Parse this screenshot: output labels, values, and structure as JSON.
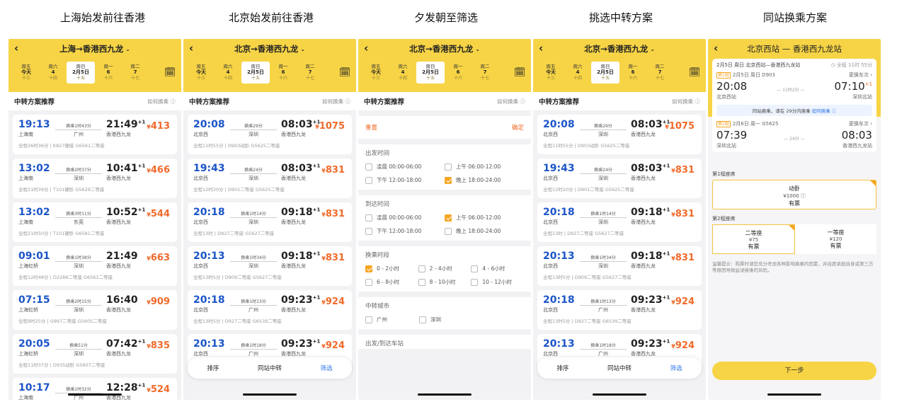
{
  "captions": [
    "上海始发前往香港",
    "北京始发前往香港",
    "夕发朝至筛选",
    "挑选中转方案",
    "同站换乘方案"
  ],
  "dates": [
    {
      "w": "周五",
      "d": "今天",
      "l": "十三"
    },
    {
      "w": "周六",
      "d": "4",
      "l": "十四"
    },
    {
      "w": "周日",
      "d": "2月5日",
      "l": "十五"
    },
    {
      "w": "周一",
      "d": "6",
      "l": "十六"
    },
    {
      "w": "周二",
      "d": "7",
      "l": "十七"
    }
  ],
  "p1": {
    "title": "上海→香港西九龙",
    "sec": "中转方案推荐",
    "help": "如何换乘 ⓘ",
    "cards": [
      {
        "dep": "19:13",
        "from": "上海南",
        "trans": "换乘1时43分",
        "via": "广州",
        "arr": "21:49",
        "plus": "+1",
        "to": "香港西九龙",
        "price": "413",
        "info": "全程26时36分 | K827硬座 G6561二等座"
      },
      {
        "dep": "13:02",
        "from": "上海南",
        "trans": "换乘2时37分",
        "via": "深圳",
        "arr": "10:41",
        "plus": "+1",
        "to": "香港西九龙",
        "price": "466",
        "info": "全程21时39分 | T101硬卧 G5629二等座"
      },
      {
        "dep": "13:02",
        "from": "上海南",
        "trans": "换乘3时11分",
        "via": "东莞",
        "arr": "10:52",
        "plus": "+1",
        "to": "香港西九龙",
        "price": "544",
        "info": "全程21时50分 | T101硬卧 G6581二等座"
      },
      {
        "dep": "09:01",
        "from": "上海虹桥",
        "trans": "换乘1时38分",
        "via": "深圳",
        "arr": "21:49",
        "plus": "",
        "to": "香港西九龙",
        "price": "663",
        "info": "全程12时48分 | D2289二等座 G6561二等座"
      },
      {
        "dep": "07:15",
        "from": "上海虹桥",
        "trans": "换乘2时15分",
        "via": "深圳",
        "arr": "16:40",
        "plus": "",
        "to": "香港西九龙",
        "price": "909",
        "info": "全程9时25分 | G997二等座 G5605二等座"
      },
      {
        "dep": "20:05",
        "from": "上海虹桥",
        "trans": "换乘51分",
        "via": "深圳",
        "arr": "07:42",
        "plus": "+1",
        "to": "香港西九龙",
        "price": "835",
        "info": "全程11时37分 | D935动卧 G5607二等座"
      },
      {
        "dep": "10:17",
        "from": "上海南",
        "trans": "换乘1时32分",
        "via": "广州",
        "arr": "12:28",
        "plus": "+1",
        "to": "香港西九龙",
        "price": "524",
        "info": ""
      }
    ]
  },
  "p2": {
    "title": "北京→香港西九龙",
    "sec": "中转方案推荐",
    "help": "如何换乘 ⓘ",
    "cards": [
      {
        "dep": "20:08",
        "from": "北京西",
        "trans": "换乘29分",
        "via": "深圳",
        "arr": "08:03",
        "plus": "+1",
        "to": "香港西九龙",
        "price": "1075",
        "info": "全程11时55分 | D903动卧 G5625二等座"
      },
      {
        "dep": "19:43",
        "from": "北京西",
        "trans": "换乘24分",
        "via": "深圳",
        "arr": "08:03",
        "plus": "+1",
        "to": "香港西九龙",
        "price": "831",
        "info": "全程12时20分 | D901二等座 G5625二等座"
      },
      {
        "dep": "20:18",
        "from": "北京西",
        "trans": "换乘1时14分",
        "via": "深圳",
        "arr": "09:18",
        "plus": "+1",
        "to": "香港西九龙",
        "price": "831",
        "info": "全程13时 | D927二等座 G5627二等座"
      },
      {
        "dep": "20:13",
        "from": "北京西",
        "trans": "换乘1时34分",
        "via": "深圳",
        "arr": "09:18",
        "plus": "+1",
        "to": "香港西九龙",
        "price": "831",
        "info": "全程13时5分 | D909二等座 G5627二等座"
      },
      {
        "dep": "20:18",
        "from": "北京西",
        "trans": "换乘1时13分",
        "via": "广州",
        "arr": "09:23",
        "plus": "+1",
        "to": "香港西九龙",
        "price": "924",
        "info": "全程13时5分 | D927二等座 G6539二等座"
      },
      {
        "dep": "20:13",
        "from": "北京西",
        "trans": "换乘1时18分",
        "via": "广州",
        "arr": "09:23",
        "plus": "+1",
        "to": "香港西九龙",
        "price": "924",
        "info": ""
      }
    ],
    "bar": [
      "排序",
      "同站中转",
      "筛选"
    ]
  },
  "p3": {
    "title": "北京→香港西九龙",
    "sec": "中转方案推荐",
    "help": "如何换乘 ⓘ",
    "reset": "重置",
    "confirm": "确定",
    "dep_t": "出发时间",
    "arr_t": "到达时间",
    "tr_t": "换乘时段",
    "city_t": "中转城市",
    "more": "出发/到达车站",
    "opts": {
      "a": "凌晨  00:00-06:00",
      "b": "上午  06:00-12:00",
      "c": "下午  12:00-18:00",
      "d": "晚上  18:00-24:00"
    },
    "tr": [
      "0 - 2小时",
      "2 - 4小时",
      "4 - 6小时",
      "6 - 8小时",
      "8 - 10小时",
      "10 - 12小时"
    ],
    "cities": [
      "广州",
      "深圳"
    ]
  },
  "p5": {
    "title": "北京西站 — 香港西九龙站",
    "sum": "2月5日 周日  北京西站—香港西九龙站",
    "total": "◷ 全程 11时 55分",
    "l1": {
      "tag": "第1程",
      "date": "2月5日 周日 D903",
      "chg": "更换车次 ›",
      "dep": "20:08",
      "dur": "11时2分",
      "arr": "07:10",
      "plus": "+1",
      "from": "北京西站",
      "to": "深圳北站"
    },
    "notice": "同站换乘，请在 29分内换乘",
    "notice_link": "如何换乘 ⓘ",
    "l2": {
      "tag": "第2程",
      "date": "2月6日 周一 G5625",
      "chg": "更换车次 ›",
      "dep": "07:39",
      "dur": "24分",
      "arr": "08:03",
      "from": "深圳北站",
      "to": "香港西九龙站"
    },
    "s1": "第1程座席",
    "seat1": {
      "n": "动卧",
      "p": "¥1000 ⓘ",
      "s": "有票"
    },
    "s2": "第2程座席",
    "seat2a": {
      "n": "二等座",
      "p": "¥75",
      "s": "有票"
    },
    "seat2b": {
      "n": "一等座",
      "p": "¥120",
      "s": "有票"
    },
    "tip": "温馨提示：购票时请您充分考虑各种影响换乘的因素，并自愿承担自身或第三方等原因导致延误换乘的风险。",
    "next": "下一步"
  }
}
